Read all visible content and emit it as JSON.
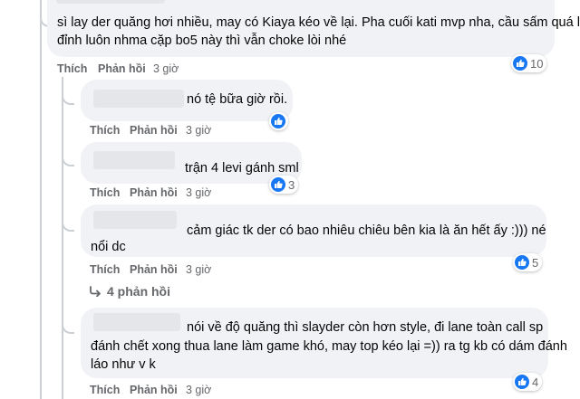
{
  "comments": [
    {
      "text_lines": [
        "sì lay der quăng hơi nhiều, may có Kiaya kéo về lại. Pha cuối kati mvp nha, cầu sấm quá là",
        "đỉnh luôn nhma cặp bo5 này thì vẫn choke lòi nhé"
      ],
      "like": "Thích",
      "reply": "Phản hồi",
      "time": "3 giờ",
      "reactions": "10"
    },
    {
      "text_lines": [
        "nó tệ bữa giờ rồi."
      ],
      "like": "Thích",
      "reply": "Phản hồi",
      "time": "3 giờ",
      "reactions": ""
    },
    {
      "text_lines": [
        "trận 4 levi gánh sml"
      ],
      "like": "Thích",
      "reply": "Phản hồi",
      "time": "3 giờ",
      "reactions": "3"
    },
    {
      "text_lines": [
        "cảm giác tk der có bao nhiêu chiêu bên kia là ăn hết ấy :)))     né",
        "nổi dc"
      ],
      "like": "Thích",
      "reply": "Phản hồi",
      "time": "3 giờ",
      "reactions": "5"
    },
    {
      "text_lines": [
        "nói về độ quăng thì slayder còn hơn style, đi lane toàn call sp",
        "đánh chết xong thua lane làm game khó, may top kéo lại =)) ra tg kb có dám đánh",
        "láo như v k"
      ],
      "like": "Thích",
      "reply": "Phản hồi",
      "time": "3 giờ",
      "reactions": "4"
    }
  ],
  "view_replies": "4 phản hồi",
  "colors": {
    "accent": "#1877f2",
    "bubble": "#f0f2f5",
    "meta": "#65676b"
  },
  "icons": {
    "reaction": "like-icon",
    "replies": "reply-arrow-icon"
  }
}
